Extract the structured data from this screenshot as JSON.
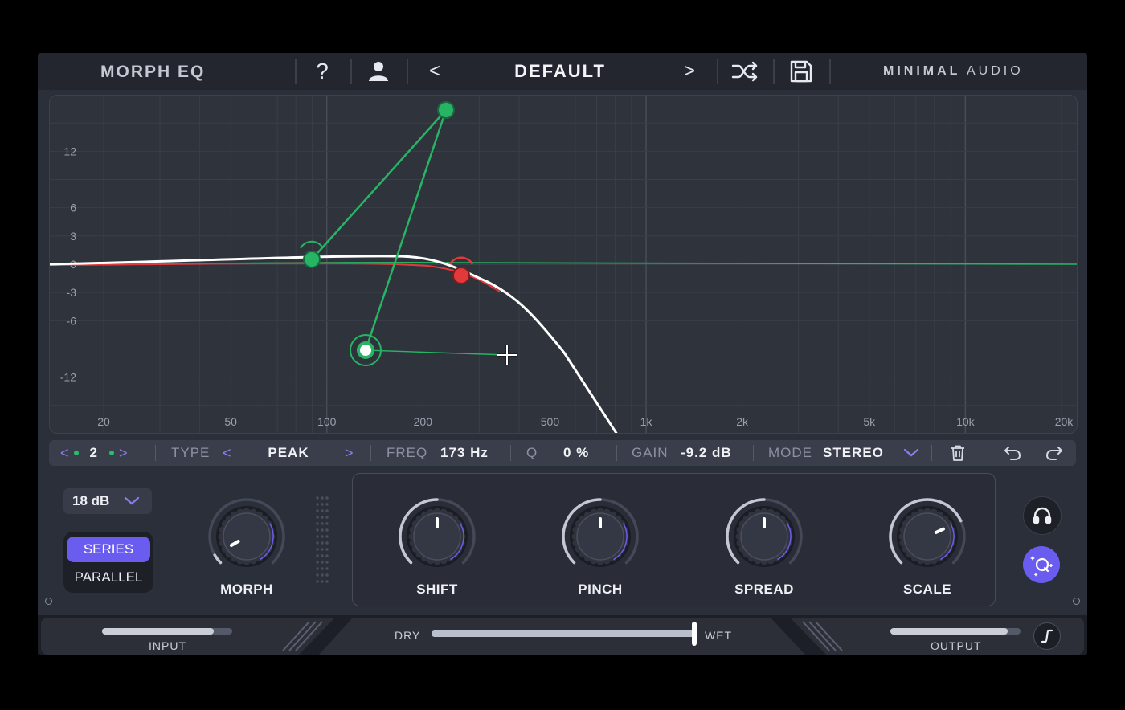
{
  "header": {
    "plugin_name": "MORPH EQ",
    "help_label": "?",
    "prev_label": "<",
    "preset_name": "DEFAULT",
    "next_label": ">",
    "brand_bold": "MINIMAL",
    "brand_light": "AUDIO",
    "icons": [
      "help-icon",
      "user-icon",
      "shuffle-icon",
      "save-icon"
    ]
  },
  "graph": {
    "db_labels": [
      "12",
      "6",
      "3",
      "0",
      "-3",
      "-6",
      "-12"
    ],
    "freq_labels": [
      "20",
      "50",
      "100",
      "200",
      "500",
      "1k",
      "2k",
      "5k",
      "10k",
      "20k"
    ],
    "colors": {
      "curve": "#ffffff",
      "band": "#27b565",
      "selected_band": "#e23a3a"
    }
  },
  "band_bar": {
    "prev_band": "<",
    "band_index": "2",
    "next_band": ">",
    "type_label": "TYPE",
    "type_prev": "<",
    "type_value": "PEAK",
    "type_next": ">",
    "freq_label": "FREQ",
    "freq_value": "173 Hz",
    "q_label": "Q",
    "q_value": "0 %",
    "gain_label": "GAIN",
    "gain_value": "-9.2 dB",
    "mode_label": "MODE",
    "mode_value": "STEREO",
    "icons": [
      "chevron-down-icon",
      "trash-icon",
      "undo-icon",
      "redo-icon"
    ]
  },
  "controls": {
    "slope_value": "18 dB",
    "series_label": "SERIES",
    "parallel_label": "PARALLEL",
    "morph_label": "MORPH",
    "macros": [
      {
        "label": "SHIFT"
      },
      {
        "label": "PINCH"
      },
      {
        "label": "SPREAD"
      },
      {
        "label": "SCALE"
      }
    ],
    "accent": "#6b5cf0"
  },
  "footer": {
    "input_label": "INPUT",
    "dry_label": "DRY",
    "wet_label": "WET",
    "output_label": "OUTPUT",
    "input_level": 0.86,
    "output_level": 0.9,
    "mix": 1.0
  }
}
